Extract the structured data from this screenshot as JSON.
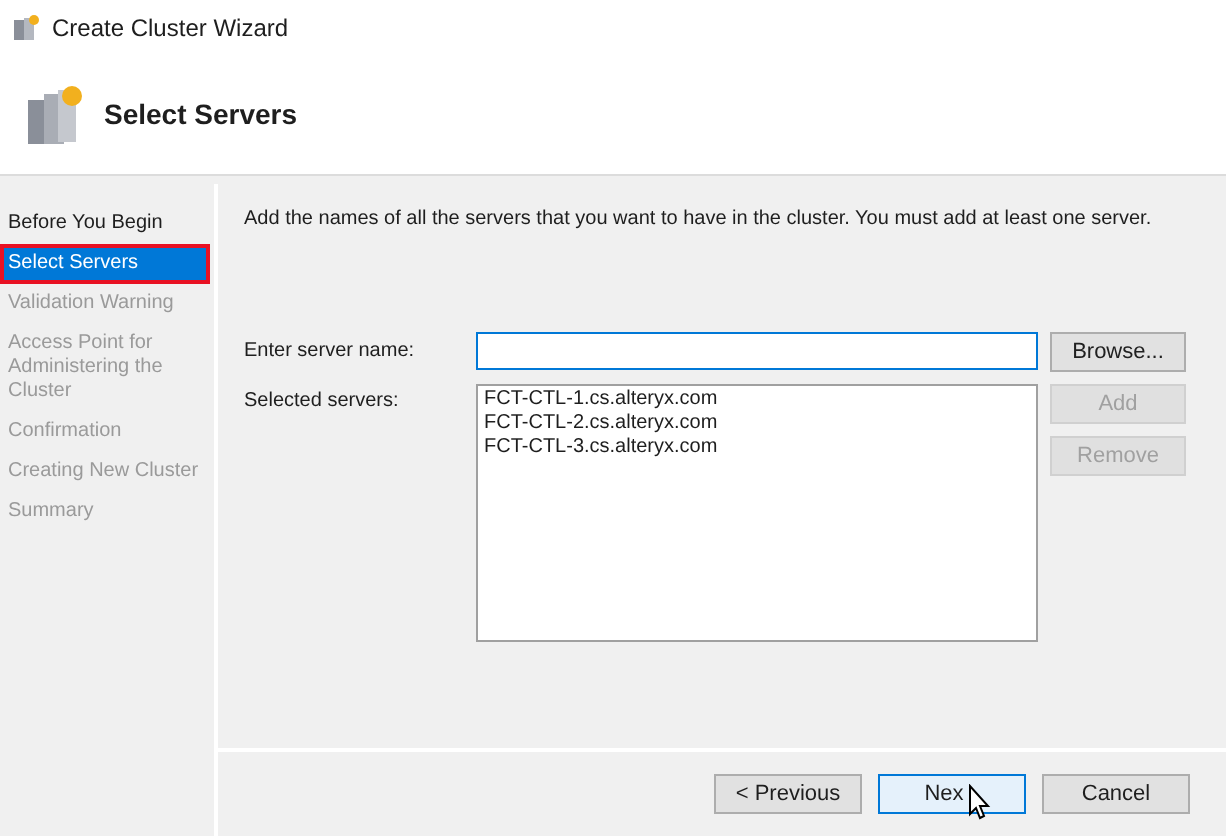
{
  "window": {
    "title": "Create Cluster Wizard"
  },
  "header": {
    "title": "Select Servers"
  },
  "steps": [
    {
      "label": "Before You Begin",
      "selected": false,
      "disabled": false
    },
    {
      "label": "Select Servers",
      "selected": true,
      "disabled": false
    },
    {
      "label": "Validation Warning",
      "selected": false,
      "disabled": true
    },
    {
      "label": "Access Point for Administering the Cluster",
      "selected": false,
      "disabled": true
    },
    {
      "label": "Confirmation",
      "selected": false,
      "disabled": true
    },
    {
      "label": "Creating New Cluster",
      "selected": false,
      "disabled": true
    },
    {
      "label": "Summary",
      "selected": false,
      "disabled": true
    }
  ],
  "instructions": "Add the names of all the servers that you want to have in the cluster. You must add at least one server.",
  "server_name": {
    "label": "Enter server name:"
  },
  "browse_button": {
    "label": "Browse...",
    "disabled": false
  },
  "selected_servers": {
    "label": "Selected servers:",
    "items": [
      "FCT-CTL-1.cs.alteryx.com",
      "FCT-CTL-2.cs.alteryx.com",
      "FCT-CTL-3.cs.alteryx.com"
    ]
  },
  "add_button": {
    "label": "Add",
    "disabled": true
  },
  "remove_button": {
    "label": "Remove",
    "disabled": true
  },
  "footer_buttons": [
    {
      "label": "< Previous",
      "selected": false
    },
    {
      "label": "Nex",
      "selected": true
    },
    {
      "label": "Cancel",
      "selected": false
    }
  ]
}
